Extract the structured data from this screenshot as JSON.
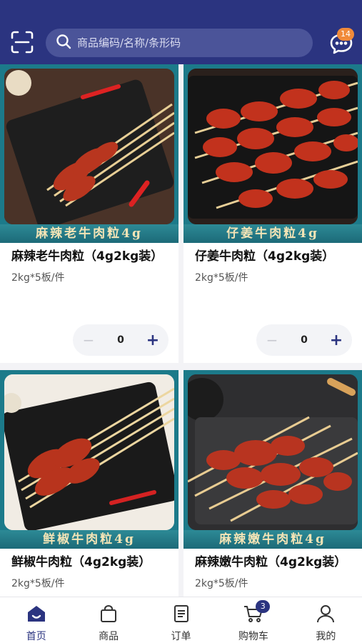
{
  "header": {
    "search_placeholder": "商品编码/名称/条形码",
    "message_badge": "14",
    "scan_icon": "scan-icon",
    "message_icon": "chat-icon"
  },
  "products": [
    {
      "banner": "麻辣老牛肉粒4g",
      "title": "麻辣老牛肉粒（4g2kg装）",
      "spec": "2kg*5板/件",
      "qty": "0"
    },
    {
      "banner": "仔姜牛肉粒4g",
      "title": "仔姜牛肉粒（4g2kg装）",
      "spec": "2kg*5板/件",
      "qty": "0"
    },
    {
      "banner": "鲜椒牛肉粒4g",
      "title": "鲜椒牛肉粒（4g2kg装）",
      "spec": "2kg*5板/件"
    },
    {
      "banner": "麻辣嫩牛肉粒4g",
      "title": "麻辣嫩牛肉粒（4g2kg装）",
      "spec": "2kg*5板/件"
    }
  ],
  "stepper": {
    "minus": "−",
    "plus": "+"
  },
  "nav": {
    "items": [
      {
        "label": "首页",
        "icon": "home-icon"
      },
      {
        "label": "商品",
        "icon": "bag-icon"
      },
      {
        "label": "订单",
        "icon": "order-icon"
      },
      {
        "label": "购物车",
        "icon": "cart-icon"
      },
      {
        "label": "我的",
        "icon": "user-icon"
      }
    ],
    "cart_badge": "3",
    "active_color": "#2b3480"
  }
}
